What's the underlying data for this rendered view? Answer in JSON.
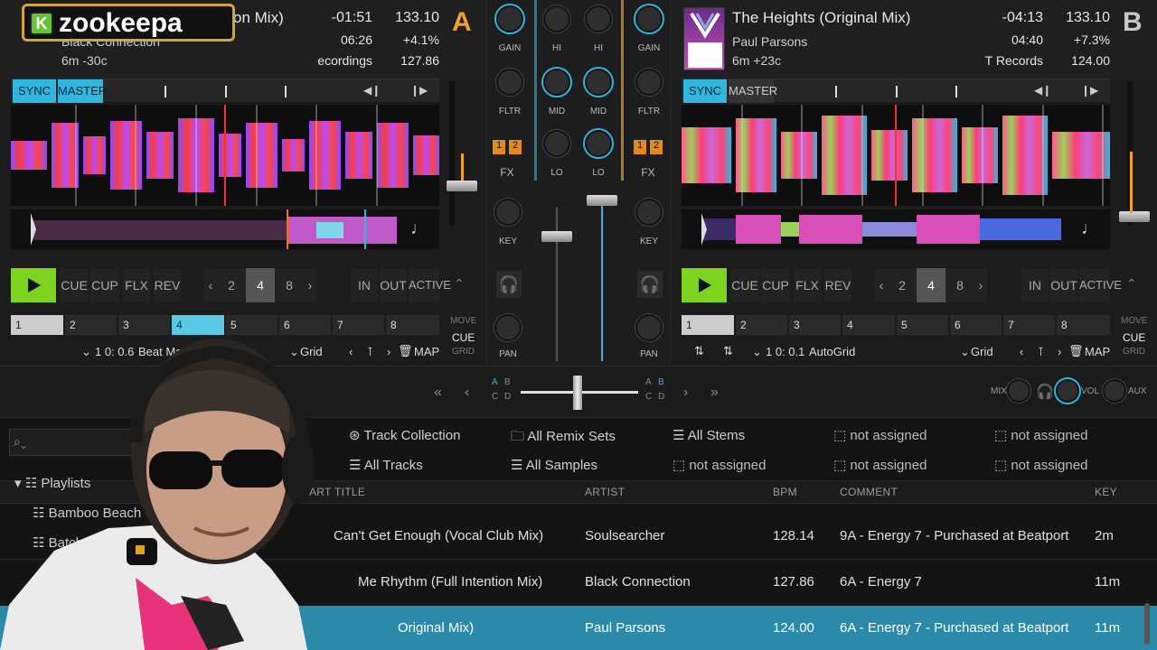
{
  "overlay": {
    "logo_text": "zookeepa",
    "logo_k": "K"
  },
  "deckA": {
    "title": "on Mix)",
    "artist": "Black Connection",
    "key_offset": "6m -30c",
    "remaining": "-01:51",
    "elapsed": "06:26",
    "label": "ecordings",
    "bpm": "133.10",
    "pitch": "+4.1%",
    "original_bpm": "127.86",
    "letter": "A",
    "sync": "SYNC",
    "master": "MASTER",
    "cue": "CUE",
    "cup": "CUP",
    "flx": "FLX",
    "rev": "REV",
    "loop_sizes": [
      "2",
      "4",
      "8"
    ],
    "loop_selected": "4",
    "in": "IN",
    "out": "OUT",
    "active": "ACTIVE",
    "hotcues": [
      "1",
      "2",
      "3",
      "4",
      "5",
      "6",
      "7",
      "8"
    ],
    "move": "MOVE",
    "cue_mode": "CUE",
    "grid_mode": "GRID",
    "beat_pos": "1 0: 0.6",
    "marker": "Beat Marker",
    "grid": "Grid",
    "map": "MAP"
  },
  "deckB": {
    "title": "The Heights (Original Mix)",
    "artist": "Paul Parsons",
    "key_offset": "6m +23c",
    "remaining": "-04:13",
    "elapsed": "04:40",
    "label": "T Records",
    "bpm": "133.10",
    "pitch": "+7.3%",
    "original_bpm": "124.00",
    "letter": "B",
    "sync": "SYNC",
    "master": "MASTER",
    "cue": "CUE",
    "cup": "CUP",
    "flx": "FLX",
    "rev": "REV",
    "loop_sizes": [
      "2",
      "4",
      "8"
    ],
    "loop_selected": "4",
    "in": "IN",
    "out": "OUT",
    "active": "ACTIVE",
    "hotcues": [
      "1",
      "2",
      "3",
      "4",
      "5",
      "6",
      "7",
      "8"
    ],
    "move": "MOVE",
    "cue_mode": "CUE",
    "grid_mode": "GRID",
    "beat_pos": "1 0: 0.1",
    "marker": "AutoGrid",
    "grid": "Grid",
    "map": "MAP"
  },
  "mixer": {
    "gain": "GAIN",
    "hi": "HI",
    "mid": "MID",
    "lo": "LO",
    "fltr": "FLTR",
    "fx": "FX",
    "key": "KEY",
    "pan": "PAN",
    "fx1": "1",
    "fx2": "2"
  },
  "crossfader": {
    "a": "A",
    "b": "B",
    "c": "C",
    "d": "D",
    "mix": "MIX",
    "vol": "VOL",
    "aux": "AUX"
  },
  "browser": {
    "favorites": [
      "Track Collection",
      "All Remix Sets",
      "All Stems",
      "not assigned",
      "not assigned",
      "All Tracks",
      "All Samples",
      "not assigned",
      "not assigned",
      "not assigned"
    ],
    "tree": {
      "playlists": "Playlists",
      "items": [
        "Bamboo Beach",
        "Batch"
      ]
    },
    "columns": {
      "art": "ART",
      "title": "TITLE",
      "artist": "ARTIST",
      "bpm": "BPM",
      "comment": "COMMENT",
      "key": "KEY"
    },
    "rows": [
      {
        "title": "Can't Get Enough (Vocal Club Mix)",
        "artist": "Soulsearcher",
        "bpm": "128.14",
        "comment": "9A - Energy 7 - Purchased at Beatport",
        "key": "2m"
      },
      {
        "title": "Me Rhythm (Full Intention Mix)",
        "artist": "Black Connection",
        "bpm": "127.86",
        "comment": "6A - Energy 7",
        "key": "11m"
      },
      {
        "title": "Original Mix)",
        "artist": "Paul Parsons",
        "bpm": "124.00",
        "comment": "6A - Energy 7 - Purchased at Beatport",
        "key": "11m"
      }
    ]
  },
  "colors": {
    "accent": "#2fb7e0",
    "play": "#7ed321",
    "deck_letter": "#f0a030",
    "logo_border": "#d6a23a"
  }
}
